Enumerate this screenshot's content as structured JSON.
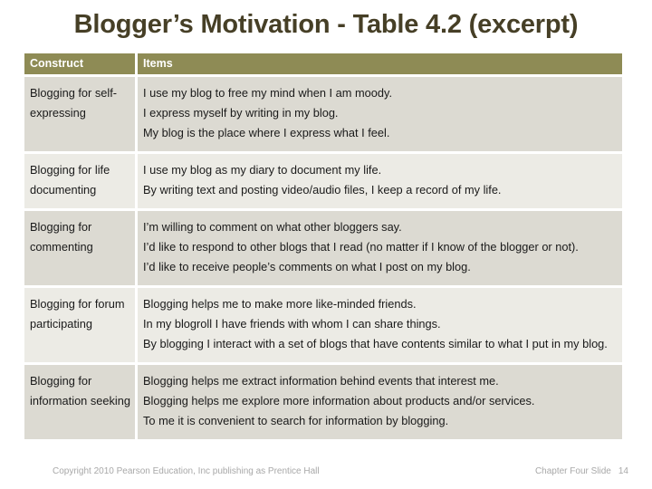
{
  "slide": {
    "title": "Blogger’s Motivation - Table 4.2 (excerpt)"
  },
  "table": {
    "headers": {
      "construct": "Construct",
      "items": "Items"
    },
    "rows": [
      {
        "construct": "Blogging for self-expressing",
        "items": [
          "I use my blog to free my mind when I am moody.",
          "I express myself by writing in my blog.",
          "My blog is the place where I express what I feel."
        ]
      },
      {
        "construct": "Blogging for life documenting",
        "items": [
          "I use my blog as my diary to document my life.",
          "By writing text and posting video/audio files, I keep a record of my life."
        ]
      },
      {
        "construct": "Blogging for commenting",
        "items": [
          "I’m willing to comment on what other bloggers say.",
          "I’d like to respond to other blogs that I read (no matter if I know of the blogger or not).",
          "I’d like to receive people’s comments on what I post on my blog."
        ]
      },
      {
        "construct": "Blogging for forum participating",
        "items": [
          "Blogging helps me to make more like-minded friends.",
          "In my blogroll I have friends with whom I can share things.",
          "By blogging I interact with a set of blogs that have contents similar to what I put in my blog."
        ]
      },
      {
        "construct": "Blogging for information seeking",
        "items": [
          "Blogging helps me extract information behind events that interest me.",
          "Blogging helps me explore more information about products and/or services.",
          "To me it is convenient to search for information by blogging."
        ]
      }
    ]
  },
  "footer": {
    "copyright": "Copyright 2010 Pearson Education, Inc  publishing as Prentice Hall",
    "chapter": "Chapter Four Slide",
    "slide_number": "14"
  },
  "colors": {
    "title_text": "#463f26",
    "header_bg": "#8e8b55",
    "header_text": "#ffffff",
    "row_dark_bg": "#dcdad2",
    "row_light_bg": "#ecebe5",
    "body_text": "#1a1a1a",
    "footer_text": "#a8a8a8",
    "slide_bg": "#ffffff"
  }
}
